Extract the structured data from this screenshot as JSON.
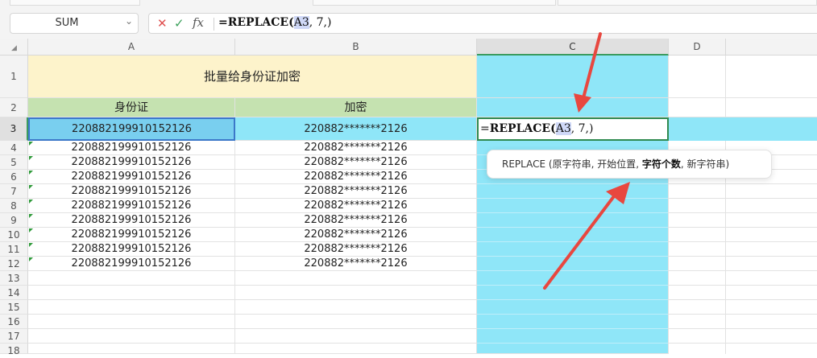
{
  "formula_bar": {
    "name_box": "SUM",
    "cancel_glyph": "✕",
    "confirm_glyph": "✓",
    "fx_glyph": "fx",
    "formula_prefix": "=REPLACE(",
    "formula_ref": "A3",
    "formula_suffix": ", 7,)"
  },
  "columns": [
    "A",
    "B",
    "C",
    "D"
  ],
  "rows": [
    "1",
    "2",
    "3",
    "4",
    "5",
    "6",
    "7",
    "8",
    "9",
    "10",
    "11",
    "12",
    "13",
    "14",
    "15",
    "16",
    "17",
    "18"
  ],
  "sheet": {
    "title": "批量给身份证加密",
    "header_a": "身份证",
    "header_b": "加密",
    "id_values": [
      "220882199910152126",
      "220882199910152126",
      "220882199910152126",
      "220882199910152126",
      "220882199910152126",
      "220882199910152126",
      "220882199910152126",
      "220882199910152126",
      "220882199910152126",
      "220882199910152126"
    ],
    "masked_values": [
      "220882*******2126",
      "220882*******2126",
      "220882*******2126",
      "220882*******2126",
      "220882*******2126",
      "220882*******2126",
      "220882*******2126",
      "220882*******2126",
      "220882*******2126",
      "220882*******2126"
    ]
  },
  "editing_cell": {
    "prefix": "=",
    "func": "REPLACE",
    "open": "(",
    "ref": "A3",
    "rest": ", 7,)"
  },
  "tooltip": {
    "func": "REPLACE",
    "args_before": "(原字符串, 开始位置, ",
    "arg_bold": "字符个数",
    "args_after": ", 新字符串)"
  },
  "colors": {
    "column_c_fill": "#8fe6f8",
    "title_fill": "#fdf3cb",
    "header_fill": "#c5e2b0",
    "arrow": "#e8473f"
  }
}
